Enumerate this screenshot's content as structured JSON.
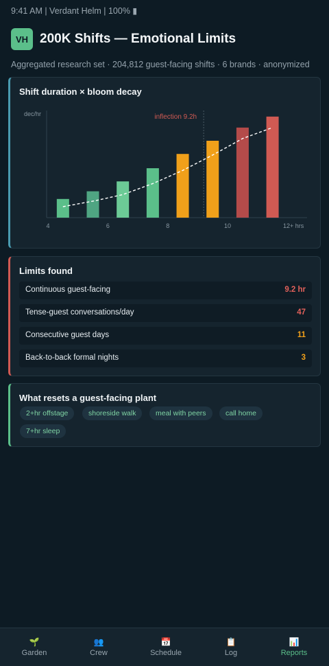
{
  "status_bar": {
    "text": "9:41 AM | Verdant Helm | 100% ▮"
  },
  "header": {
    "avatar": "VH",
    "title": "200K Shifts — Emotional Limits",
    "subtitle": "Aggregated research set · 204,812 guest-facing shifts · 6 brands · anonymized"
  },
  "chart_card": {
    "title": "Shift duration × bloom decay"
  },
  "chart_data": {
    "type": "bar",
    "title": "Shift duration × bloom decay",
    "ylabel": "dec/hr",
    "xlabel": "",
    "x_ticks": [
      "4",
      "6",
      "8",
      "10",
      "12+ hrs"
    ],
    "categories": [
      "4.5",
      "5.5",
      "6.5",
      "7.5",
      "8.5",
      "9.5",
      "10.5",
      "11.5"
    ],
    "values": [
      17,
      24,
      33,
      45,
      58,
      70,
      82,
      92
    ],
    "bar_colors": [
      "#5bbf8a",
      "#4fa582",
      "#6cca96",
      "#5bbf8a",
      "#f0a01a",
      "#f0a01a",
      "#b44b4a",
      "#d05a53"
    ],
    "trend": [
      10,
      15,
      21,
      31,
      43,
      57,
      72,
      82
    ],
    "ylim": [
      0,
      100
    ],
    "inflection": {
      "x": 9.2,
      "label": "inflection 9.2h",
      "color": "#d05a53"
    },
    "grid": false
  },
  "limits_card": {
    "title": "Limits found",
    "rows": [
      {
        "label": "Continuous guest-facing",
        "value": "9.2 hr",
        "color": "#e0605a"
      },
      {
        "label": "Tense-guest conversations/day",
        "value": "47",
        "color": "#e0605a"
      },
      {
        "label": "Consecutive guest days",
        "value": "11",
        "color": "#f0a01a"
      },
      {
        "label": "Back-to-back formal nights",
        "value": "3",
        "color": "#f0a01a"
      }
    ]
  },
  "resets_card": {
    "title": "What resets a guest-facing plant",
    "chips": [
      "2+hr offstage",
      "shoreside walk",
      "meal with peers",
      "call home",
      "7+hr sleep"
    ]
  },
  "nav": {
    "items": [
      {
        "icon": "🌱",
        "icon_name": "sprout-icon",
        "label": "Garden"
      },
      {
        "icon": "👥",
        "icon_name": "crew-icon",
        "label": "Crew"
      },
      {
        "icon": "📅",
        "icon_name": "calendar-icon",
        "label": "Schedule"
      },
      {
        "icon": "📋",
        "icon_name": "clipboard-icon",
        "label": "Log"
      },
      {
        "icon": "📊",
        "icon_name": "bar-chart-icon",
        "label": "Reports"
      }
    ],
    "active": "Reports"
  }
}
